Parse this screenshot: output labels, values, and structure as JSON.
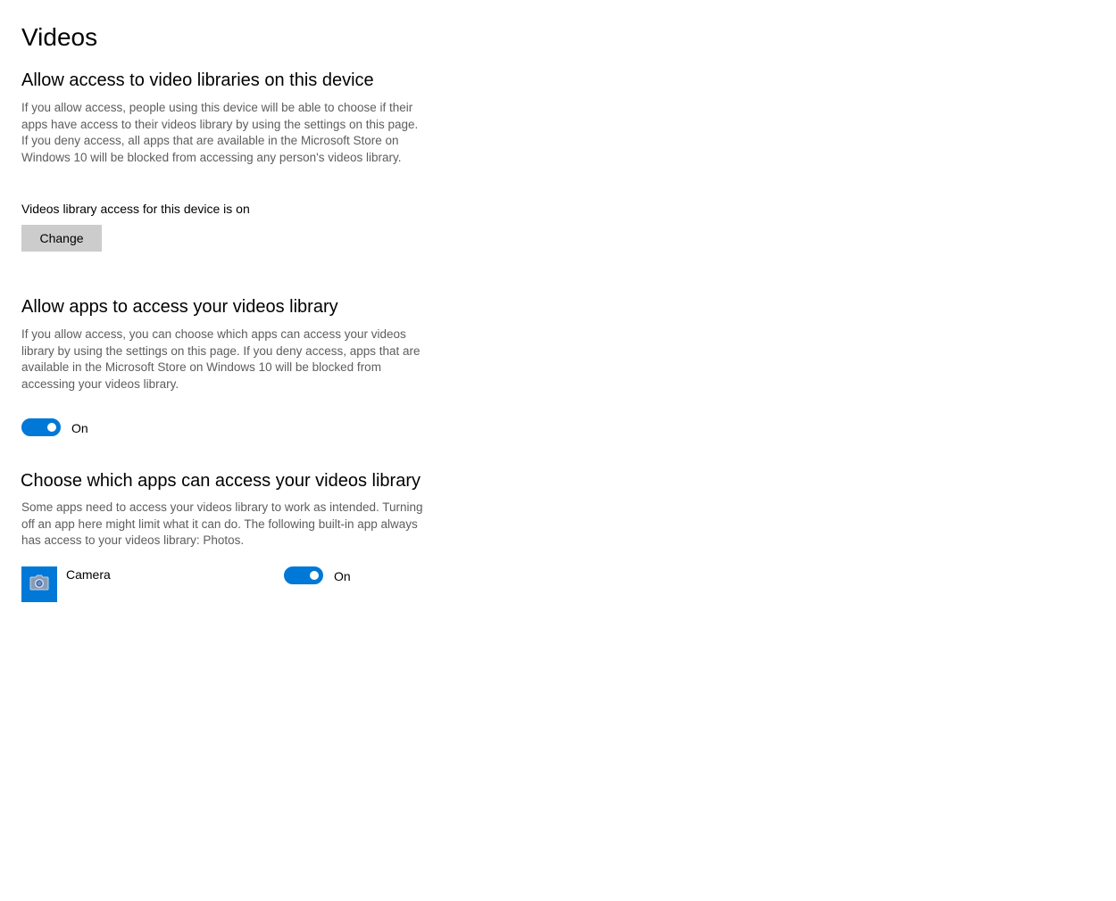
{
  "page": {
    "title": "Videos"
  },
  "colors": {
    "accent": "#0078d7",
    "button_bg": "#cccccc",
    "secondary_text": "#5d5d5d"
  },
  "device_access": {
    "title": "Allow access to video libraries on this device",
    "description": "If you allow access, people using this device will be able to choose if their apps have access to their videos library by using the settings on this page. If you deny access, all apps that are available in the Microsoft Store on Windows 10 will be blocked from accessing any person's videos library.",
    "status": "Videos library access for this device is on",
    "change_label": "Change"
  },
  "app_access": {
    "title": "Allow apps to access your videos library",
    "description": "If you allow access, you can choose which apps can access your videos library by using the settings on this page. If you deny access, apps that are available in the Microsoft Store on Windows 10 will be blocked from accessing your videos library.",
    "toggle_on": true,
    "toggle_label": "On"
  },
  "choose_apps": {
    "title": "Choose which apps can access your videos library",
    "description": "Some apps need to access your videos library to work as intended. Turning off an app here might limit what it can do. The following built-in app always has access to your videos library: Photos.",
    "apps": [
      {
        "name": "Camera",
        "icon": "camera-icon",
        "icon_bg": "#0078d7",
        "toggle_on": true,
        "toggle_label": "On"
      }
    ]
  }
}
